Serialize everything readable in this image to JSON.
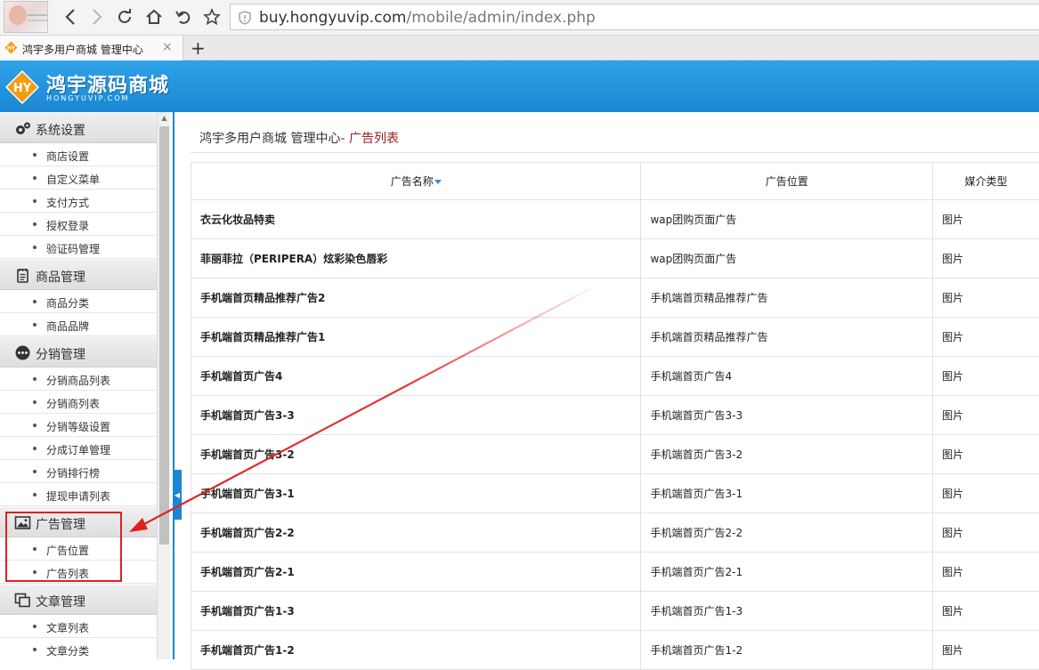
{
  "browser": {
    "url_host": "buy.hongyuvip.com",
    "url_path": "/mobile/admin/index.php",
    "tab_title": "鸿宇多用户商城 管理中心",
    "tab_close": "×",
    "new_tab": "+"
  },
  "header": {
    "logo_badge": "HY",
    "logo_text": "鸿宇源码商城",
    "logo_sub": "HONGYUVIP.COM",
    "bg_color": "#1b86d3"
  },
  "sidebar": {
    "sections": [
      {
        "title": "系统设置",
        "icon": "gears-icon",
        "items": [
          "商店设置",
          "自定义菜单",
          "支付方式",
          "授权登录",
          "验证码管理"
        ]
      },
      {
        "title": "商品管理",
        "icon": "notepad-icon",
        "items": [
          "商品分类",
          "商品品牌"
        ]
      },
      {
        "title": "分销管理",
        "icon": "ellipsis-circle-icon",
        "items": [
          "分销商品列表",
          "分销商列表",
          "分销等级设置",
          "分成订单管理",
          "分销排行榜",
          "提现申请列表"
        ]
      },
      {
        "title": "广告管理",
        "icon": "picture-icon",
        "items": [
          "广告位置",
          "广告列表"
        ]
      },
      {
        "title": "文章管理",
        "icon": "copy-icon",
        "items": [
          "文章列表",
          "文章分类"
        ]
      }
    ]
  },
  "main": {
    "breadcrumb_root": "鸿宇多用户商城 管理中心",
    "breadcrumb_sep": "- ",
    "breadcrumb_current": "广告列表",
    "table": {
      "columns": [
        "广告名称",
        "广告位置",
        "媒介类型"
      ],
      "rows": [
        [
          "衣云化妆品特卖",
          "wap团购页面广告",
          "图片"
        ],
        [
          "菲丽菲拉（PERIPERA）炫彩染色唇彩",
          "wap团购页面广告",
          "图片"
        ],
        [
          "手机端首页精品推荐广告2",
          "手机端首页精品推荐广告",
          "图片"
        ],
        [
          "手机端首页精品推荐广告1",
          "手机端首页精品推荐广告",
          "图片"
        ],
        [
          "手机端首页广告4",
          "手机端首页广告4",
          "图片"
        ],
        [
          "手机端首页广告3-3",
          "手机端首页广告3-3",
          "图片"
        ],
        [
          "手机端首页广告3-2",
          "手机端首页广告3-2",
          "图片"
        ],
        [
          "手机端首页广告3-1",
          "手机端首页广告3-1",
          "图片"
        ],
        [
          "手机端首页广告2-2",
          "手机端首页广告2-2",
          "图片"
        ],
        [
          "手机端首页广告2-1",
          "手机端首页广告2-1",
          "图片"
        ],
        [
          "手机端首页广告1-3",
          "手机端首页广告1-3",
          "图片"
        ],
        [
          "手机端首页广告1-2",
          "手机端首页广告1-2",
          "图片"
        ]
      ]
    }
  },
  "annotation": {
    "color": "#e02020"
  }
}
